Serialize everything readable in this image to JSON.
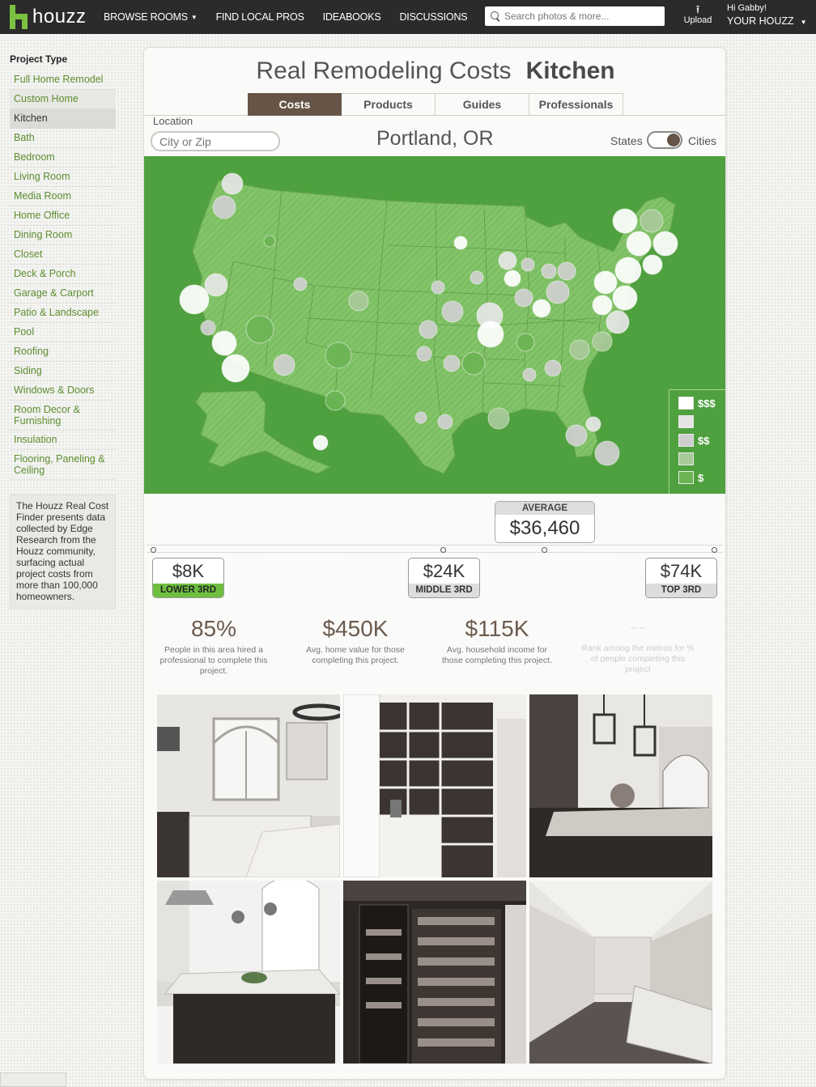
{
  "topbar": {
    "logo_text": "houzz",
    "nav": [
      {
        "label": "BROWSE ROOMS",
        "has_caret": true
      },
      {
        "label": "FIND LOCAL PROS"
      },
      {
        "label": "IDEABOOKS"
      },
      {
        "label": "DISCUSSIONS"
      }
    ],
    "search_placeholder": "Search photos & more...",
    "upload_label": "Upload",
    "greeting": "Hi Gabby!",
    "your_houzz": "YOUR HOUZZ"
  },
  "sidebar": {
    "heading": "Project Type",
    "items": [
      {
        "label": "Full Home Remodel"
      },
      {
        "label": "Custom Home",
        "state": "hover"
      },
      {
        "label": "Kitchen",
        "state": "selected"
      },
      {
        "label": "Bath"
      },
      {
        "label": "Bedroom"
      },
      {
        "label": "Living Room"
      },
      {
        "label": "Media Room"
      },
      {
        "label": "Home Office"
      },
      {
        "label": "Dining Room"
      },
      {
        "label": "Closet"
      },
      {
        "label": "Deck & Porch"
      },
      {
        "label": "Garage & Carport"
      },
      {
        "label": "Patio & Landscape"
      },
      {
        "label": "Pool"
      },
      {
        "label": "Roofing"
      },
      {
        "label": "Siding"
      },
      {
        "label": "Windows & Doors"
      },
      {
        "label": "Room Decor & Furnishing"
      },
      {
        "label": "Insulation"
      },
      {
        "label": "Flooring, Paneling & Ceiling"
      }
    ],
    "info": "The Houzz Real Cost Finder presents data collected by Edge Research from the Houzz community, surfacing actual project costs from more than 100,000 homeowners."
  },
  "main": {
    "title": "Real Remodeling Costs",
    "title_bold": "Kitchen",
    "tabs": [
      "Costs",
      "Products",
      "Guides",
      "Professionals"
    ],
    "active_tab": "Costs",
    "location_label": "Location",
    "location_placeholder": "City or Zip",
    "city": "Portland, OR",
    "toggle_left": "States",
    "toggle_right": "Cities",
    "toggle_value": "Cities",
    "map_color": "#4fa03e",
    "legend": [
      "$$$",
      "",
      "$$",
      "",
      "$"
    ],
    "average_label": "AVERAGE",
    "average_value": "$36,460",
    "ranges": [
      {
        "value": "$8K",
        "label": "LOWER 3RD"
      },
      {
        "value": "$24K",
        "label": "MIDDLE 3RD"
      },
      {
        "value": "$74K",
        "label": "TOP 3RD"
      }
    ],
    "stats": [
      {
        "big": "85%",
        "small": "People in this area hired a professional to complete this project."
      },
      {
        "big": "$450K",
        "small": "Avg. home value for those completing this project."
      },
      {
        "big": "$115K",
        "small": "Avg. household income for those completing this project."
      },
      {
        "big": "-- --",
        "small": "Rank among the metros for % of people completing this project"
      }
    ],
    "photos": [
      "kitchen-photo",
      "pantry-photo",
      "kitchen-island-photo",
      "white-kitchen-photo",
      "pantry-cabinet-photo",
      "kitchen-aisle-photo"
    ]
  }
}
